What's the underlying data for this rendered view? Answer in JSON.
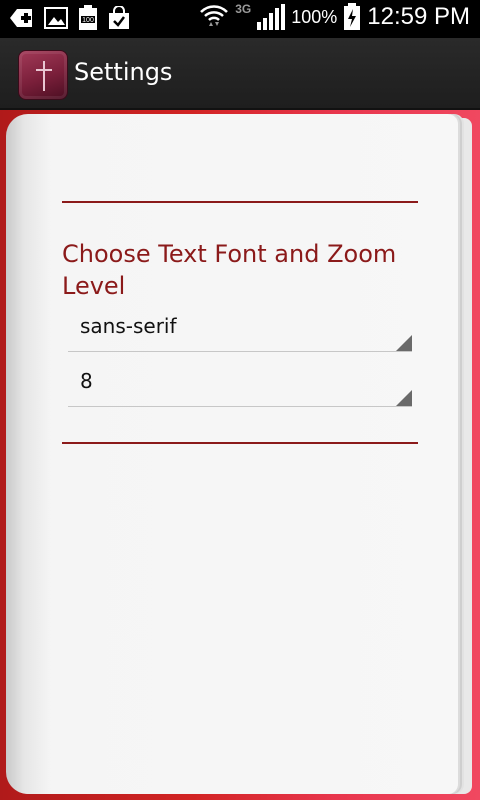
{
  "status_bar": {
    "battery_percent": "100%",
    "network_type": "3G",
    "time": "12:59 PM",
    "icons": [
      "add-icon",
      "image-icon",
      "battery-100-icon",
      "shopping-bag-icon",
      "wifi-icon",
      "signal-icon",
      "battery-charging-icon"
    ]
  },
  "action_bar": {
    "title": "Settings",
    "icon": "bible-cross-icon"
  },
  "settings": {
    "section_title": "Choose Text Font and Zoom Level",
    "font_select": {
      "value": "sans-serif"
    },
    "zoom_select": {
      "value": "8"
    }
  },
  "colors": {
    "accent": "#8b1a1a",
    "book_cover": "#d22424",
    "page": "#f7f7f7",
    "action_bar": "#222222"
  }
}
